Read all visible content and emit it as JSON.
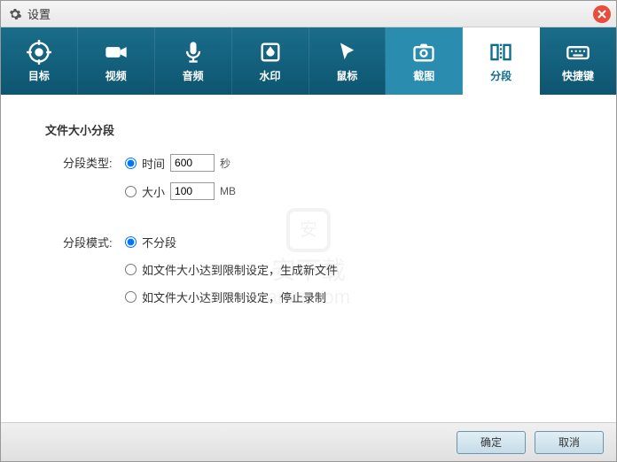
{
  "window": {
    "title": "设置"
  },
  "tabs": [
    {
      "label": "目标"
    },
    {
      "label": "视频"
    },
    {
      "label": "音频"
    },
    {
      "label": "水印"
    },
    {
      "label": "鼠标"
    },
    {
      "label": "截图"
    },
    {
      "label": "分段"
    },
    {
      "label": "快捷键"
    }
  ],
  "content": {
    "section_title": "文件大小分段",
    "type_label": "分段类型:",
    "type_opts": {
      "time": {
        "label": "时间",
        "value": "600",
        "unit": "秒"
      },
      "size": {
        "label": "大小",
        "value": "100",
        "unit": "MB"
      }
    },
    "mode_label": "分段模式:",
    "mode_opts": {
      "none": "不分段",
      "newfile": "如文件大小达到限制设定，生成新文件",
      "stop": "如文件大小达到限制设定，停止录制"
    }
  },
  "watermark": {
    "line1": "安下载",
    "line2": "anxz.com"
  },
  "buttons": {
    "ok": "确定",
    "cancel": "取消"
  }
}
